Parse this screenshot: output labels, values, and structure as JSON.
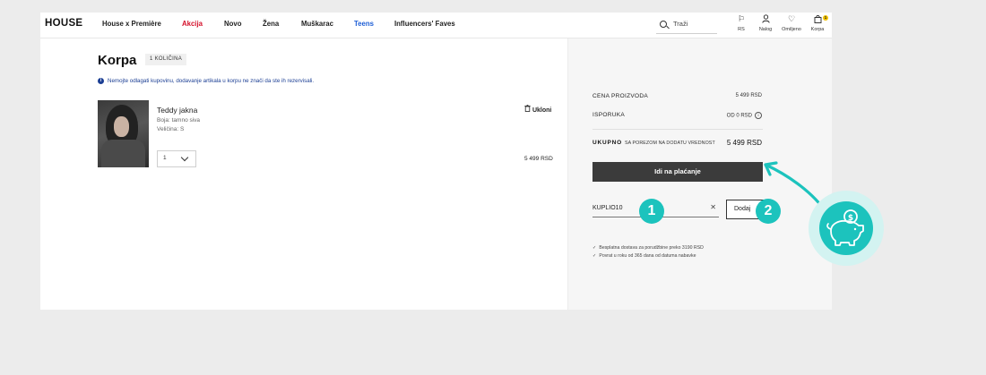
{
  "brand": {
    "logo": "HOUSE"
  },
  "nav": {
    "items": [
      {
        "label": "House x Première",
        "color": "#222222"
      },
      {
        "label": "Akcija",
        "color": "#d4102a"
      },
      {
        "label": "Novo",
        "color": "#222222"
      },
      {
        "label": "Žena",
        "color": "#222222"
      },
      {
        "label": "Muškarac",
        "color": "#222222"
      },
      {
        "label": "Teens",
        "color": "#1f5fd6"
      },
      {
        "label": "Influencers' Faves",
        "color": "#222222"
      }
    ]
  },
  "search": {
    "placeholder": "Traži",
    "icon": "search-icon"
  },
  "top_icons": [
    {
      "label": "RS",
      "icon": "flag-icon"
    },
    {
      "label": "Nalog",
      "icon": "user-icon"
    },
    {
      "label": "Omiljeno",
      "icon": "heart-icon"
    },
    {
      "label": "Korpa",
      "icon": "cart-icon",
      "badge": "1"
    }
  ],
  "cart": {
    "title": "Korpa",
    "quantity_badge": "1 KOLIČINA",
    "notice": "Nemojte odlagati kupovinu, dodavanje artikala u korpu ne znači da ste ih rezervisali.",
    "remove_label": "Ukloni",
    "item": {
      "name": "Teddy jakna",
      "color_line": "Boja: tamno siva",
      "size_line": "Veličina: S",
      "quantity": "1",
      "price": "5 499 RSD"
    }
  },
  "summary": {
    "product_price_label": "CENA PROIZVODA",
    "product_price_value": "5 499 RSD",
    "shipping_label": "ISPORUKA",
    "shipping_value": "OD 0 RSD",
    "total_label": "UKUPNO",
    "total_note": "SA POREZOM NA DODATU VREDNOST",
    "total_value": "5 499 RSD",
    "checkout_label": "Idi na plaćanje",
    "coupon_value": "KUPLIO10",
    "coupon_clear": "✕",
    "add_label": "Dodaj",
    "perks": [
      "Besplatna dostava za porudžbine preko 3190 RSD",
      "Povrat u roku od 365 dana od datuma nabavke"
    ]
  },
  "annotations": {
    "step1": "1",
    "step2": "2",
    "accent_color": "#1cc3bd"
  }
}
